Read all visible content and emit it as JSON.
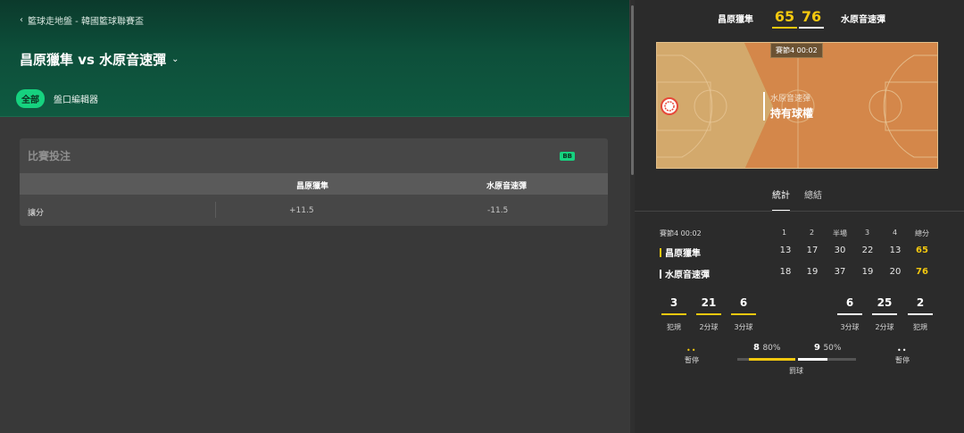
{
  "breadcrumb": {
    "text": "籃球走地盤 - 韓國籃球聯賽盃"
  },
  "match": {
    "title": "昌原獵隼 vs 水原音速彈"
  },
  "filters": {
    "all": "全部",
    "editor": "盤口編輯器"
  },
  "bet_card": {
    "title": "比賽投注",
    "badge": "BB",
    "col_home": "昌原獵隼",
    "col_away": "水原音速彈",
    "rows": [
      {
        "label": "讓分",
        "home": "+11.5",
        "away": "-11.5"
      }
    ]
  },
  "scoreboard": {
    "home_team": "昌原獵隼",
    "away_team": "水原音速彈",
    "home_score": "65",
    "away_score": "76"
  },
  "court": {
    "period_badge": "賽節4  00:02",
    "possession_team": "水原音速彈",
    "possession_text": "持有球權"
  },
  "tabs": {
    "stats": "統計",
    "summary": "總結"
  },
  "table": {
    "period_label": "賽節4  00:02",
    "headers": [
      "1",
      "2",
      "半場",
      "3",
      "4",
      "總分"
    ],
    "home": {
      "name": "昌原獵隼",
      "values": [
        "13",
        "17",
        "30",
        "22",
        "13",
        "65"
      ]
    },
    "away": {
      "name": "水原音速彈",
      "values": [
        "18",
        "19",
        "37",
        "19",
        "20",
        "76"
      ]
    }
  },
  "team_stats": {
    "home": {
      "fouls": "3",
      "two_pt": "21",
      "three_pt": "6"
    },
    "away": {
      "three_pt": "6",
      "two_pt": "25",
      "fouls": "2"
    },
    "labels": {
      "fouls": "犯規",
      "two_pt": "2分球",
      "three_pt": "3分球",
      "timeout": "暫停",
      "free_throw": "罰球"
    },
    "timeouts_home": "••",
    "timeouts_away": "••",
    "free_throw": {
      "home_made": "8",
      "home_pct": "80%",
      "away_made": "9",
      "away_pct": "50%",
      "home_ratio": 0.8,
      "away_ratio": 0.5
    }
  },
  "colors": {
    "home": "#f3c80f",
    "away": "#ffffff",
    "accent": "#16d27f",
    "hero": "#0d4f3a",
    "court": "#c99c5c"
  }
}
